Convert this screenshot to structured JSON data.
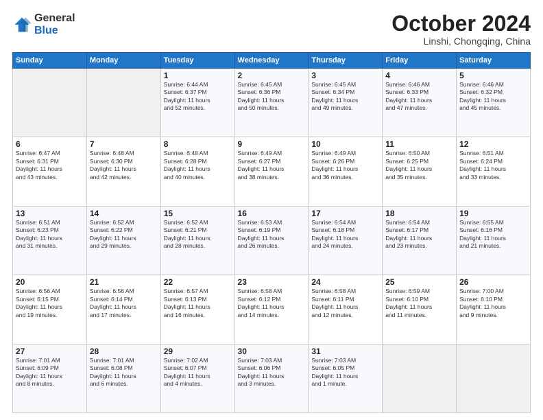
{
  "header": {
    "logo": {
      "general": "General",
      "blue": "Blue"
    },
    "title": "October 2024",
    "location": "Linshi, Chongqing, China"
  },
  "calendar": {
    "days_of_week": [
      "Sunday",
      "Monday",
      "Tuesday",
      "Wednesday",
      "Thursday",
      "Friday",
      "Saturday"
    ],
    "weeks": [
      [
        {
          "day": "",
          "empty": true
        },
        {
          "day": "",
          "empty": true
        },
        {
          "day": "1",
          "info": "Sunrise: 6:44 AM\nSunset: 6:37 PM\nDaylight: 11 hours\nand 52 minutes."
        },
        {
          "day": "2",
          "info": "Sunrise: 6:45 AM\nSunset: 6:36 PM\nDaylight: 11 hours\nand 50 minutes."
        },
        {
          "day": "3",
          "info": "Sunrise: 6:45 AM\nSunset: 6:34 PM\nDaylight: 11 hours\nand 49 minutes."
        },
        {
          "day": "4",
          "info": "Sunrise: 6:46 AM\nSunset: 6:33 PM\nDaylight: 11 hours\nand 47 minutes."
        },
        {
          "day": "5",
          "info": "Sunrise: 6:46 AM\nSunset: 6:32 PM\nDaylight: 11 hours\nand 45 minutes."
        }
      ],
      [
        {
          "day": "6",
          "info": "Sunrise: 6:47 AM\nSunset: 6:31 PM\nDaylight: 11 hours\nand 43 minutes."
        },
        {
          "day": "7",
          "info": "Sunrise: 6:48 AM\nSunset: 6:30 PM\nDaylight: 11 hours\nand 42 minutes."
        },
        {
          "day": "8",
          "info": "Sunrise: 6:48 AM\nSunset: 6:28 PM\nDaylight: 11 hours\nand 40 minutes."
        },
        {
          "day": "9",
          "info": "Sunrise: 6:49 AM\nSunset: 6:27 PM\nDaylight: 11 hours\nand 38 minutes."
        },
        {
          "day": "10",
          "info": "Sunrise: 6:49 AM\nSunset: 6:26 PM\nDaylight: 11 hours\nand 36 minutes."
        },
        {
          "day": "11",
          "info": "Sunrise: 6:50 AM\nSunset: 6:25 PM\nDaylight: 11 hours\nand 35 minutes."
        },
        {
          "day": "12",
          "info": "Sunrise: 6:51 AM\nSunset: 6:24 PM\nDaylight: 11 hours\nand 33 minutes."
        }
      ],
      [
        {
          "day": "13",
          "info": "Sunrise: 6:51 AM\nSunset: 6:23 PM\nDaylight: 11 hours\nand 31 minutes."
        },
        {
          "day": "14",
          "info": "Sunrise: 6:52 AM\nSunset: 6:22 PM\nDaylight: 11 hours\nand 29 minutes."
        },
        {
          "day": "15",
          "info": "Sunrise: 6:52 AM\nSunset: 6:21 PM\nDaylight: 11 hours\nand 28 minutes."
        },
        {
          "day": "16",
          "info": "Sunrise: 6:53 AM\nSunset: 6:19 PM\nDaylight: 11 hours\nand 26 minutes."
        },
        {
          "day": "17",
          "info": "Sunrise: 6:54 AM\nSunset: 6:18 PM\nDaylight: 11 hours\nand 24 minutes."
        },
        {
          "day": "18",
          "info": "Sunrise: 6:54 AM\nSunset: 6:17 PM\nDaylight: 11 hours\nand 23 minutes."
        },
        {
          "day": "19",
          "info": "Sunrise: 6:55 AM\nSunset: 6:16 PM\nDaylight: 11 hours\nand 21 minutes."
        }
      ],
      [
        {
          "day": "20",
          "info": "Sunrise: 6:56 AM\nSunset: 6:15 PM\nDaylight: 11 hours\nand 19 minutes."
        },
        {
          "day": "21",
          "info": "Sunrise: 6:56 AM\nSunset: 6:14 PM\nDaylight: 11 hours\nand 17 minutes."
        },
        {
          "day": "22",
          "info": "Sunrise: 6:57 AM\nSunset: 6:13 PM\nDaylight: 11 hours\nand 16 minutes."
        },
        {
          "day": "23",
          "info": "Sunrise: 6:58 AM\nSunset: 6:12 PM\nDaylight: 11 hours\nand 14 minutes."
        },
        {
          "day": "24",
          "info": "Sunrise: 6:58 AM\nSunset: 6:11 PM\nDaylight: 11 hours\nand 12 minutes."
        },
        {
          "day": "25",
          "info": "Sunrise: 6:59 AM\nSunset: 6:10 PM\nDaylight: 11 hours\nand 11 minutes."
        },
        {
          "day": "26",
          "info": "Sunrise: 7:00 AM\nSunset: 6:10 PM\nDaylight: 11 hours\nand 9 minutes."
        }
      ],
      [
        {
          "day": "27",
          "info": "Sunrise: 7:01 AM\nSunset: 6:09 PM\nDaylight: 11 hours\nand 8 minutes."
        },
        {
          "day": "28",
          "info": "Sunrise: 7:01 AM\nSunset: 6:08 PM\nDaylight: 11 hours\nand 6 minutes."
        },
        {
          "day": "29",
          "info": "Sunrise: 7:02 AM\nSunset: 6:07 PM\nDaylight: 11 hours\nand 4 minutes."
        },
        {
          "day": "30",
          "info": "Sunrise: 7:03 AM\nSunset: 6:06 PM\nDaylight: 11 hours\nand 3 minutes."
        },
        {
          "day": "31",
          "info": "Sunrise: 7:03 AM\nSunset: 6:05 PM\nDaylight: 11 hours\nand 1 minute."
        },
        {
          "day": "",
          "empty": true
        },
        {
          "day": "",
          "empty": true
        }
      ]
    ]
  }
}
